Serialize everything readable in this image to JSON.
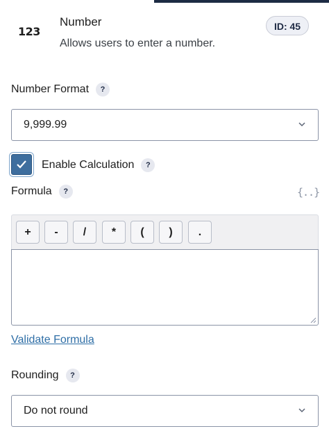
{
  "field": {
    "icon_text": "123",
    "title": "Number",
    "description": "Allows users to enter a number.",
    "id_badge": "ID: 45"
  },
  "number_format": {
    "label": "Number Format",
    "help": "?",
    "value": "9,999.99"
  },
  "calculation": {
    "checked": true,
    "label": "Enable Calculation",
    "help": "?"
  },
  "formula": {
    "label": "Formula",
    "help": "?",
    "merge_tag_icon": "{..}",
    "operators": [
      "+",
      "-",
      "/",
      "*",
      "(",
      ")",
      "."
    ],
    "value": "",
    "validate_link": "Validate Formula"
  },
  "rounding": {
    "label": "Rounding",
    "help": "?",
    "value": "Do not round"
  },
  "colors": {
    "accent": "#3e6e9e",
    "link": "#2e6ea6",
    "topbar": "#1d2b44"
  }
}
